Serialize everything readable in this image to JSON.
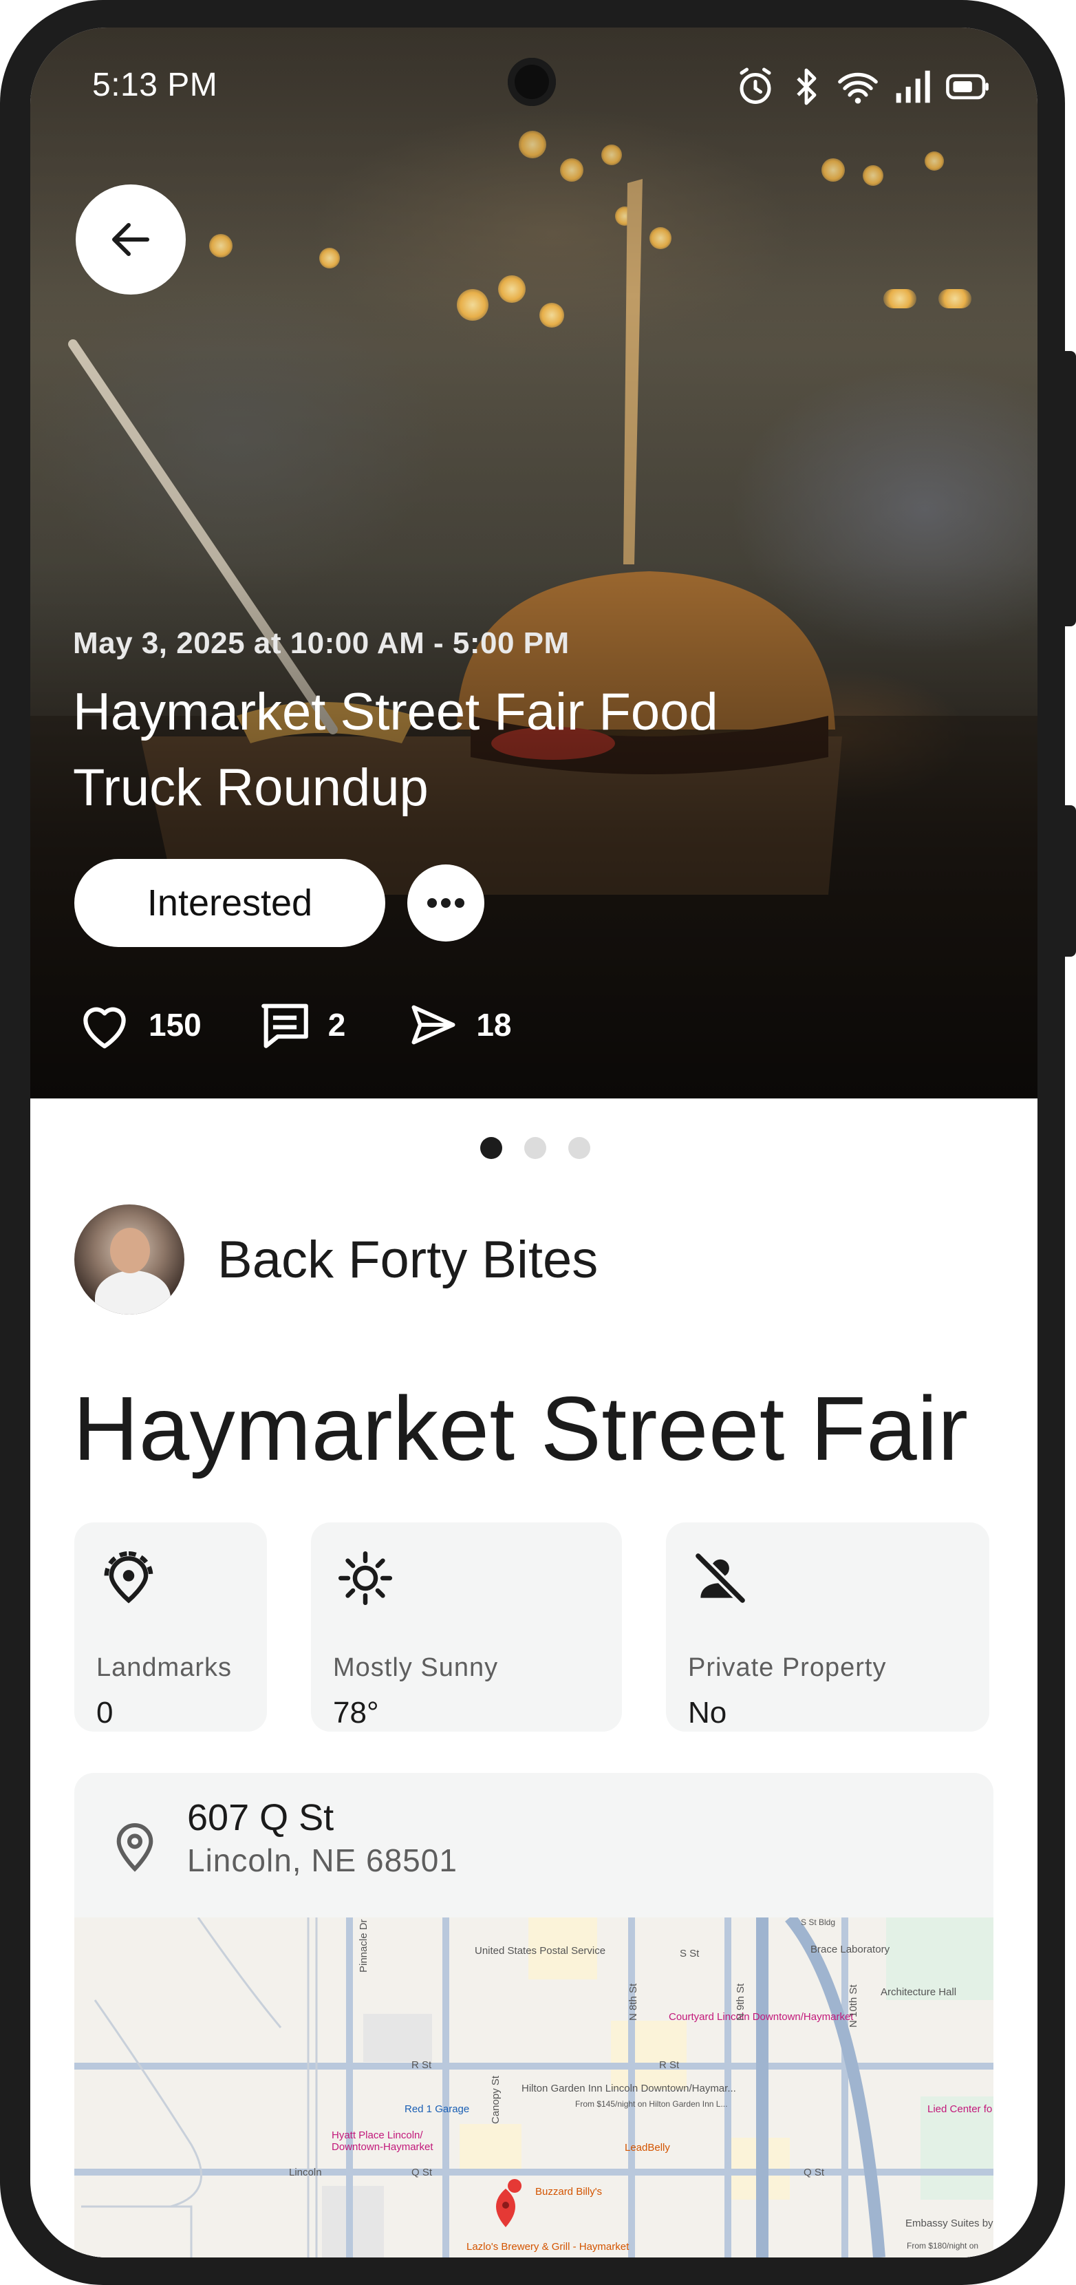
{
  "status_bar": {
    "time": "5:13 PM"
  },
  "hero": {
    "date": "May 3, 2025 at 10:00 AM - 5:00 PM",
    "title": "Haymarket Street Fair Food Truck Roundup",
    "interested_label": "Interested",
    "stats": {
      "likes": "150",
      "comments": "2",
      "shares": "18"
    }
  },
  "carousel": {
    "count": 3,
    "active": 0
  },
  "organizer": {
    "name": "Back Forty Bites"
  },
  "event": {
    "name": "Haymarket Street Fair"
  },
  "info_cards": [
    {
      "icon": "landmark-pin-icon",
      "label": "Landmarks",
      "value": "0"
    },
    {
      "icon": "sun-icon",
      "label": "Mostly Sunny",
      "value": "78°"
    },
    {
      "icon": "no-person-icon",
      "label": "Private Property",
      "value": "No"
    }
  ],
  "address": {
    "line1": "607 Q St",
    "line2": "Lincoln, NE 68501"
  },
  "map": {
    "labels": {
      "post_office": "United States Postal Service",
      "brace_lab": "Brace Laboratory",
      "architecture_hall": "Architecture Hall",
      "courtyard": "Courtyard Lincoln Downtown/Haymarket",
      "hilton": "Hilton Garden Inn Lincoln Downtown/Haymar...",
      "hilton_price": "From $145/night on Hilton Garden Inn L...",
      "garage": "Red 1 Garage",
      "hyatt": "Hyatt Place Lincoln/ Downtown-Haymarket",
      "leadbelly": "LeadBelly",
      "buzzard": "Buzzard Billy's",
      "lied": "Lied Center fo Performing Art",
      "lincoln": "Lincoln",
      "lazlos": "Lazlo's Brewery & Grill - Haymarket",
      "embassy": "Embassy Suites by Hilton Lincoln",
      "embassy_price": "From $180/night on",
      "r_st": "R St",
      "q_st": "Q St",
      "s_st": "S St",
      "s_bldg": "S St Bldg",
      "canopy": "Canopy St",
      "n8th": "N 8th St",
      "n9th": "N 9th St",
      "n10th": "N 10th St",
      "pinnacle": "Pinnacle Dr"
    }
  },
  "colors": {
    "accent": "#1b1b1b",
    "card_bg": "#f4f5f5",
    "map_pin": "#e53935"
  }
}
